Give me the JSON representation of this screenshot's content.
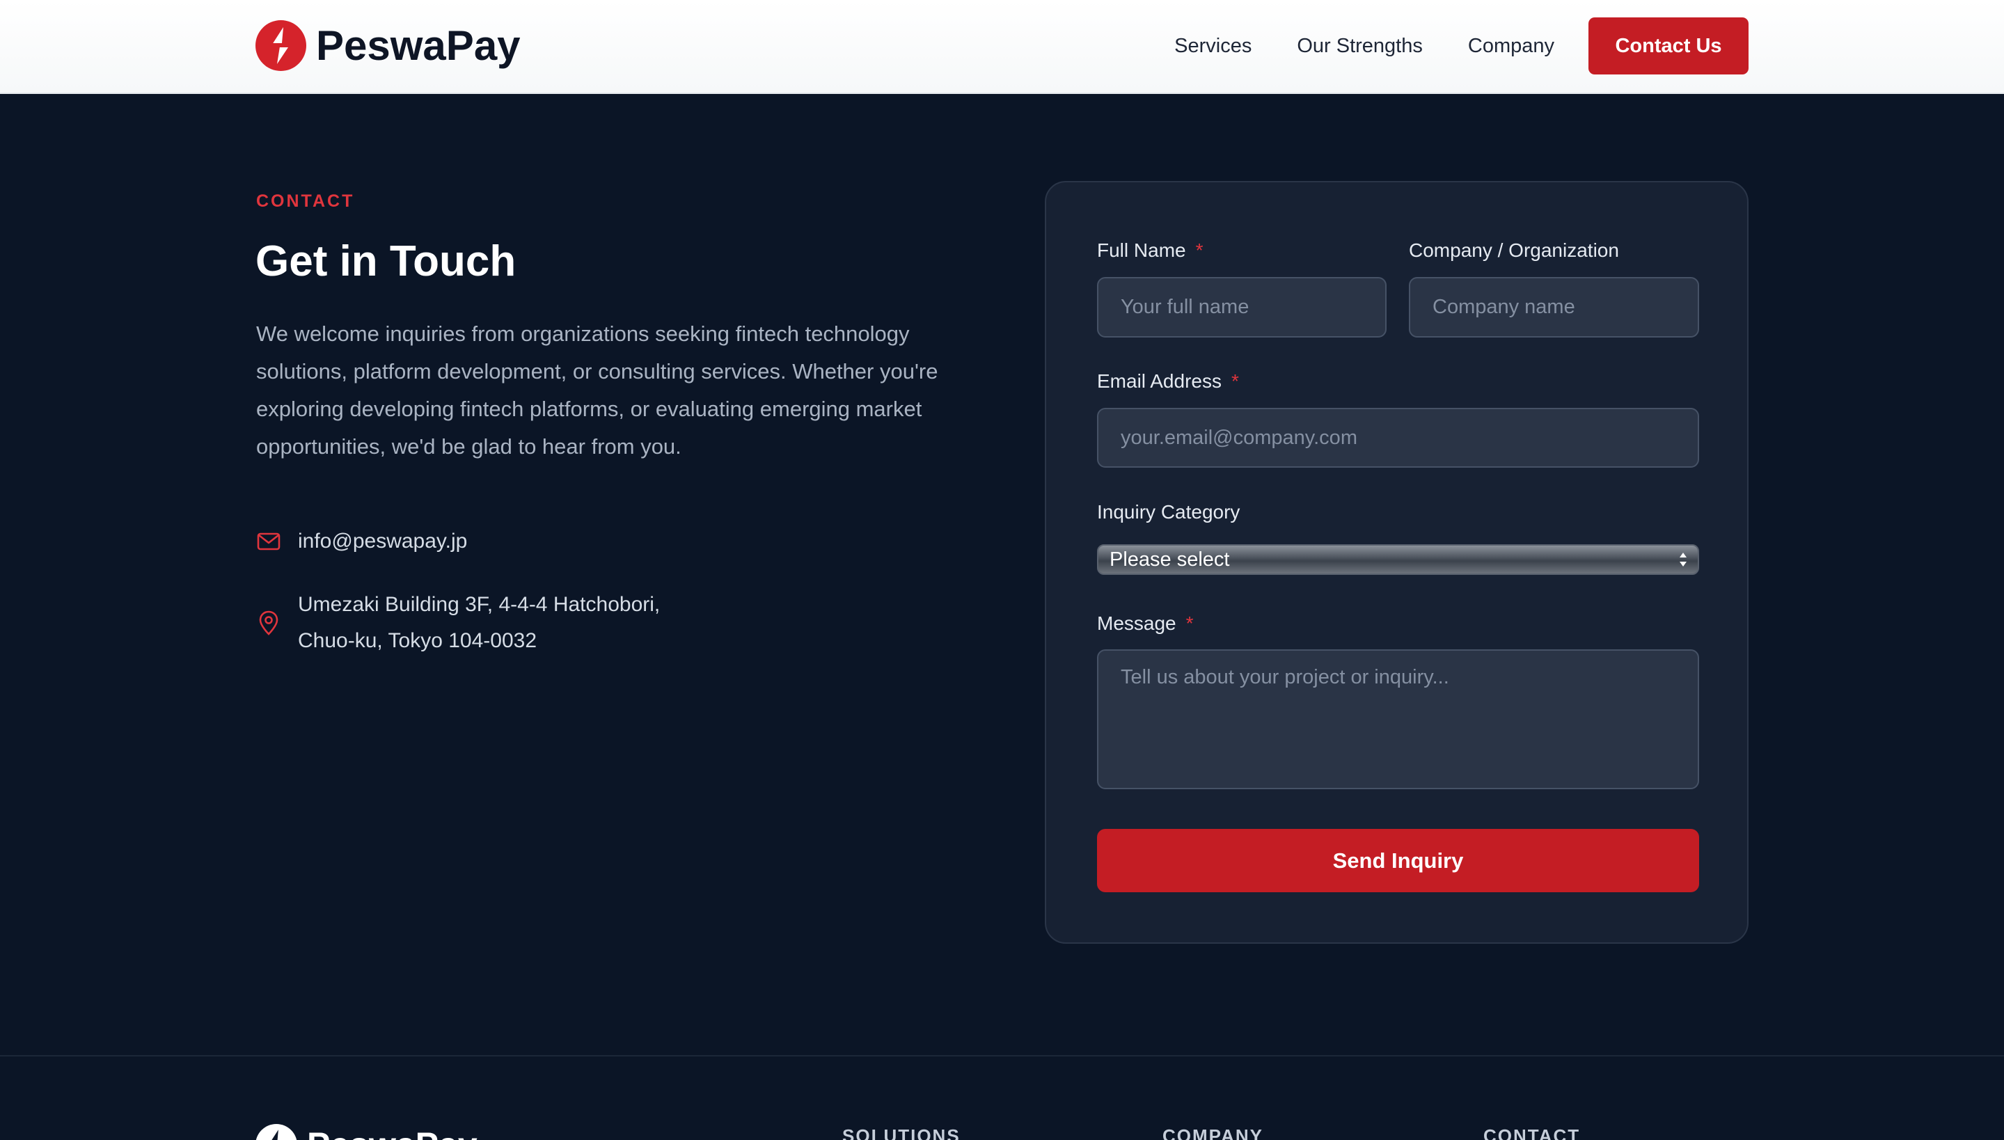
{
  "brand": {
    "name": "PeswaPay",
    "accent": "#c41d24",
    "background": "#0b1526"
  },
  "nav": {
    "links": [
      "Services",
      "Our Strengths",
      "Company"
    ],
    "cta": "Contact Us"
  },
  "contact": {
    "eyebrow": "CONTACT",
    "title": "Get in Touch",
    "intro": "We welcome inquiries from organizations seeking fintech technology solutions, platform development, or consulting services. Whether you're exploring developing fintech platforms, or evaluating emerging market opportunities, we'd be glad to hear from you.",
    "email": "info@peswapay.jp",
    "address_line1": "Umezaki Building 3F, 4-4-4 Hatchobori,",
    "address_line2": "Chuo-ku, Tokyo 104-0032"
  },
  "form": {
    "full_name": {
      "label": "Full Name",
      "required": "*",
      "placeholder": "Your full name",
      "value": ""
    },
    "company": {
      "label": "Company / Organization",
      "placeholder": "Company name",
      "value": ""
    },
    "email": {
      "label": "Email Address",
      "required": "*",
      "placeholder": "your.email@company.com",
      "value": ""
    },
    "category": {
      "label": "Inquiry Category",
      "selected": "Please select"
    },
    "message": {
      "label": "Message",
      "required": "*",
      "placeholder": "Tell us about your project or inquiry...",
      "value": ""
    },
    "submit": "Send Inquiry"
  },
  "footer": {
    "brand": "PeswaPay",
    "headings": [
      "SOLUTIONS",
      "COMPANY",
      "CONTACT"
    ]
  }
}
